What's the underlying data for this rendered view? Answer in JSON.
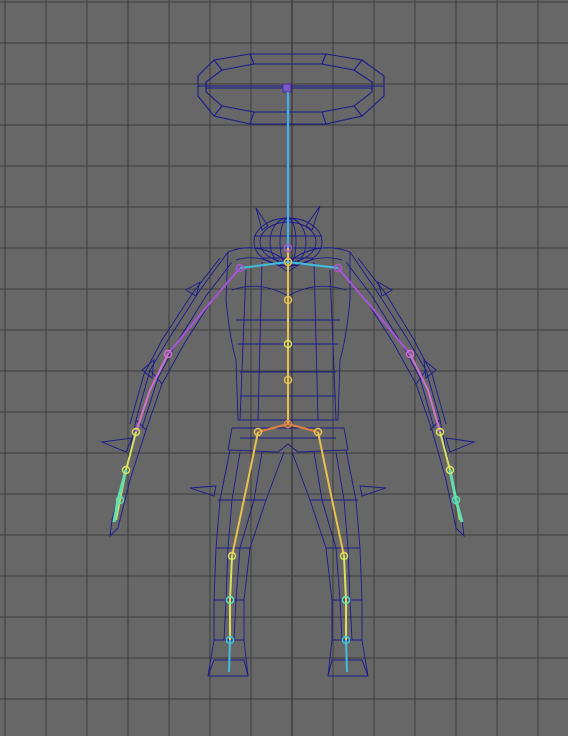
{
  "viewport": {
    "view": "front",
    "display_mode": "wireframe",
    "background_color": "#676767",
    "grid_color": "#3c3c3c",
    "grid_axis_color": "#2a2a2a",
    "mesh_color": "#1a1a8e",
    "mesh_highlight_color": "#2828b8"
  },
  "rig": {
    "name": "character-skeleton",
    "color_ramp": [
      "#3ab0ff",
      "#a855d8",
      "#d070d0",
      "#e6c050",
      "#d8e060",
      "#60e0b0",
      "#40c0e0",
      "#e08040"
    ]
  }
}
